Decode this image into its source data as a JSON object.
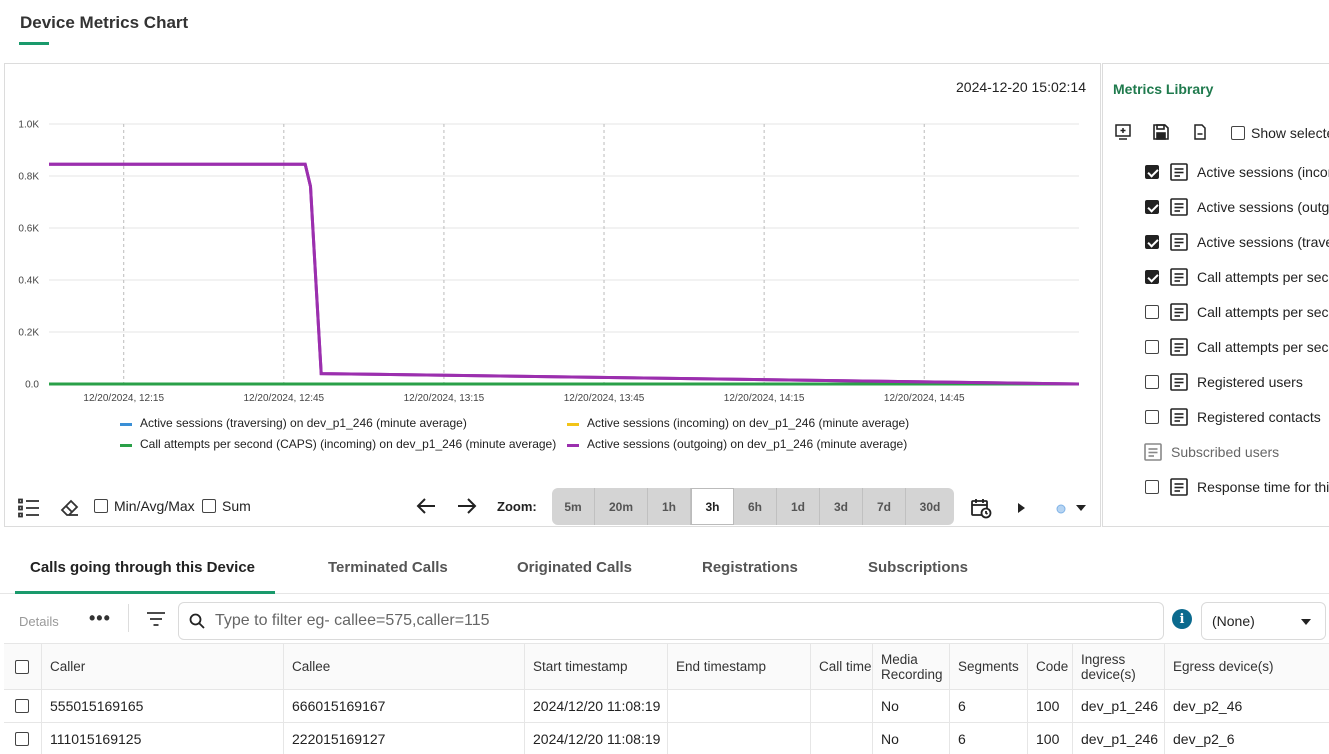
{
  "page": {
    "title": "Device Metrics Chart"
  },
  "chart": {
    "timestamp": "2024-12-20 15:02:14",
    "legend": {
      "items": [
        {
          "label": "Active sessions (traversing) on dev_p1_246 (minute average)",
          "color": "#3a8fd6"
        },
        {
          "label": "Active sessions (incoming) on dev_p1_246 (minute average)",
          "color": "#f2c418"
        },
        {
          "label": "Call attempts per second (CAPS) (incoming) on dev_p1_246 (minute average)",
          "color": "#2aa048"
        },
        {
          "label": "Active sessions (outgoing) on dev_p1_246 (minute average)",
          "color": "#9b2fae"
        }
      ]
    },
    "toolbar": {
      "minavgmax_label": "Min/Avg/Max",
      "sum_label": "Sum",
      "zoom_label": "Zoom:",
      "zoom_options": [
        "5m",
        "20m",
        "1h",
        "3h",
        "6h",
        "1d",
        "3d",
        "7d",
        "30d"
      ],
      "zoom_selected": "3h"
    }
  },
  "chart_data": {
    "type": "line",
    "x_ticks": [
      "12/20/2024, 12:15",
      "12/20/2024, 12:45",
      "12/20/2024, 13:15",
      "12/20/2024, 13:45",
      "12/20/2024, 14:15",
      "12/20/2024, 14:45"
    ],
    "y_ticks": [
      "0.0",
      "0.2K",
      "0.4K",
      "0.6K",
      "0.8K",
      "1.0K"
    ],
    "ylim": [
      0,
      1000
    ],
    "xlim_minutes_from_1215": [
      -14,
      165
    ],
    "grid": true,
    "legend_placement": "bottom",
    "series": [
      {
        "name": "Active sessions (outgoing) on dev_p1_246 (minute average)",
        "color": "#9b2fae",
        "x": [
          -14,
          34,
          35,
          36,
          37,
          179
        ],
        "y": [
          845,
          845,
          760,
          400,
          40,
          0
        ]
      },
      {
        "name": "Call attempts per second (CAPS) (incoming) on dev_p1_246 (minute average)",
        "color": "#2aa048",
        "x": [
          -14,
          179
        ],
        "y": [
          0,
          0
        ]
      },
      {
        "name": "Active sessions (traversing) on dev_p1_246 (minute average)",
        "color": "#3a8fd6",
        "x": [
          -14,
          179
        ],
        "y": [
          0,
          0
        ]
      },
      {
        "name": "Active sessions (incoming) on dev_p1_246 (minute average)",
        "color": "#f2c418",
        "x": [
          -14,
          179
        ],
        "y": [
          0,
          0
        ]
      }
    ]
  },
  "library": {
    "title": "Metrics Library",
    "show_selected_label": "Show selected",
    "items": [
      {
        "label": "Active sessions (incoming)",
        "checked": true
      },
      {
        "label": "Active sessions (outgoing)",
        "checked": true
      },
      {
        "label": "Active sessions (traversing)",
        "checked": true
      },
      {
        "label": "Call attempts per second",
        "checked": true
      },
      {
        "label": "Call attempts per second",
        "checked": false
      },
      {
        "label": "Call attempts per second",
        "checked": false
      },
      {
        "label": "Registered users",
        "checked": false
      },
      {
        "label": "Registered contacts",
        "checked": false
      },
      {
        "label": "Subscribed users",
        "checked": null
      },
      {
        "label": "Response time for this",
        "checked": false
      }
    ]
  },
  "tabs": [
    {
      "label": "Calls going through this Device",
      "active": true
    },
    {
      "label": "Terminated Calls",
      "active": false
    },
    {
      "label": "Originated Calls",
      "active": false
    },
    {
      "label": "Registrations",
      "active": false
    },
    {
      "label": "Subscriptions",
      "active": false
    }
  ],
  "filter": {
    "details_label": "Details",
    "more_label": "•••",
    "search_placeholder": "Type to filter eg- callee=575,caller=115",
    "select_value": "(None)"
  },
  "table": {
    "columns": [
      "Caller",
      "Callee",
      "Start timestamp",
      "End timestamp",
      "Call time",
      "Media Recording",
      "Segments",
      "Code",
      "Ingress device(s)",
      "Egress device(s)"
    ],
    "rows": [
      [
        "555015169165",
        "666015169167",
        "2024/12/20 11:08:19",
        "",
        "",
        "No",
        "6",
        "100",
        "dev_p1_246",
        "dev_p2_46"
      ],
      [
        "111015169125",
        "222015169127",
        "2024/12/20 11:08:19",
        "",
        "",
        "No",
        "6",
        "100",
        "dev_p1_246",
        "dev_p2_6"
      ]
    ]
  }
}
